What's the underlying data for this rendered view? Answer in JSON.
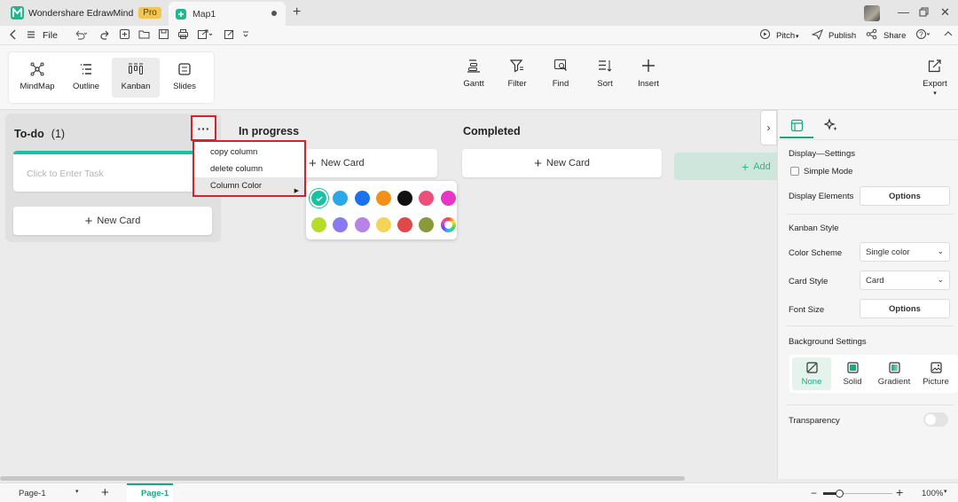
{
  "titlebar": {
    "app_name": "Wondershare EdrawMind",
    "badge": "Pro",
    "doc_tab": "Map1"
  },
  "menubar": {
    "file": "File",
    "pitch": "Pitch",
    "publish": "Publish",
    "share": "Share"
  },
  "views": [
    "MindMap",
    "Outline",
    "Kanban",
    "Slides"
  ],
  "tools": [
    "Gantt",
    "Filter",
    "Find",
    "Sort",
    "Insert",
    "Export"
  ],
  "kanban": {
    "todo": {
      "title": "To-do",
      "count": "(1)",
      "task_placeholder": "Click to Enter Task",
      "new_card": "New Card"
    },
    "in_progress": {
      "title": "In progress",
      "new_card": "New Card"
    },
    "completed": {
      "title": "Completed",
      "new_card": "New Card"
    },
    "add_column": "Add",
    "more_glyph": "···"
  },
  "context_menu": {
    "items": [
      "copy column",
      "delete column",
      "Column Color"
    ]
  },
  "palette": {
    "row1": [
      "#17c3a2",
      "#2ba8e8",
      "#1a73e8",
      "#f39019",
      "#111111",
      "#ee4f7a",
      "#e536c8"
    ],
    "row2": [
      "#b8dd29",
      "#8a7af0",
      "#b883e6",
      "#f4d35b",
      "#e04949",
      "#8a9a3a",
      "custom"
    ]
  },
  "panel": {
    "display_settings": "Display—Settings",
    "simple_mode": "Simple Mode",
    "display_elements": "Display Elements",
    "options": "Options",
    "kanban_style": "Kanban Style",
    "color_scheme": "Color Scheme",
    "color_scheme_value": "Single color",
    "card_style": "Card Style",
    "card_style_value": "Card",
    "font_size": "Font Size",
    "background_settings": "Background Settings",
    "bg_options": [
      "None",
      "Solid",
      "Gradient",
      "Picture"
    ],
    "transparency": "Transparency"
  },
  "statusbar": {
    "page_select": "Page-1",
    "page_tab": "Page-1",
    "zoom": "100%"
  }
}
